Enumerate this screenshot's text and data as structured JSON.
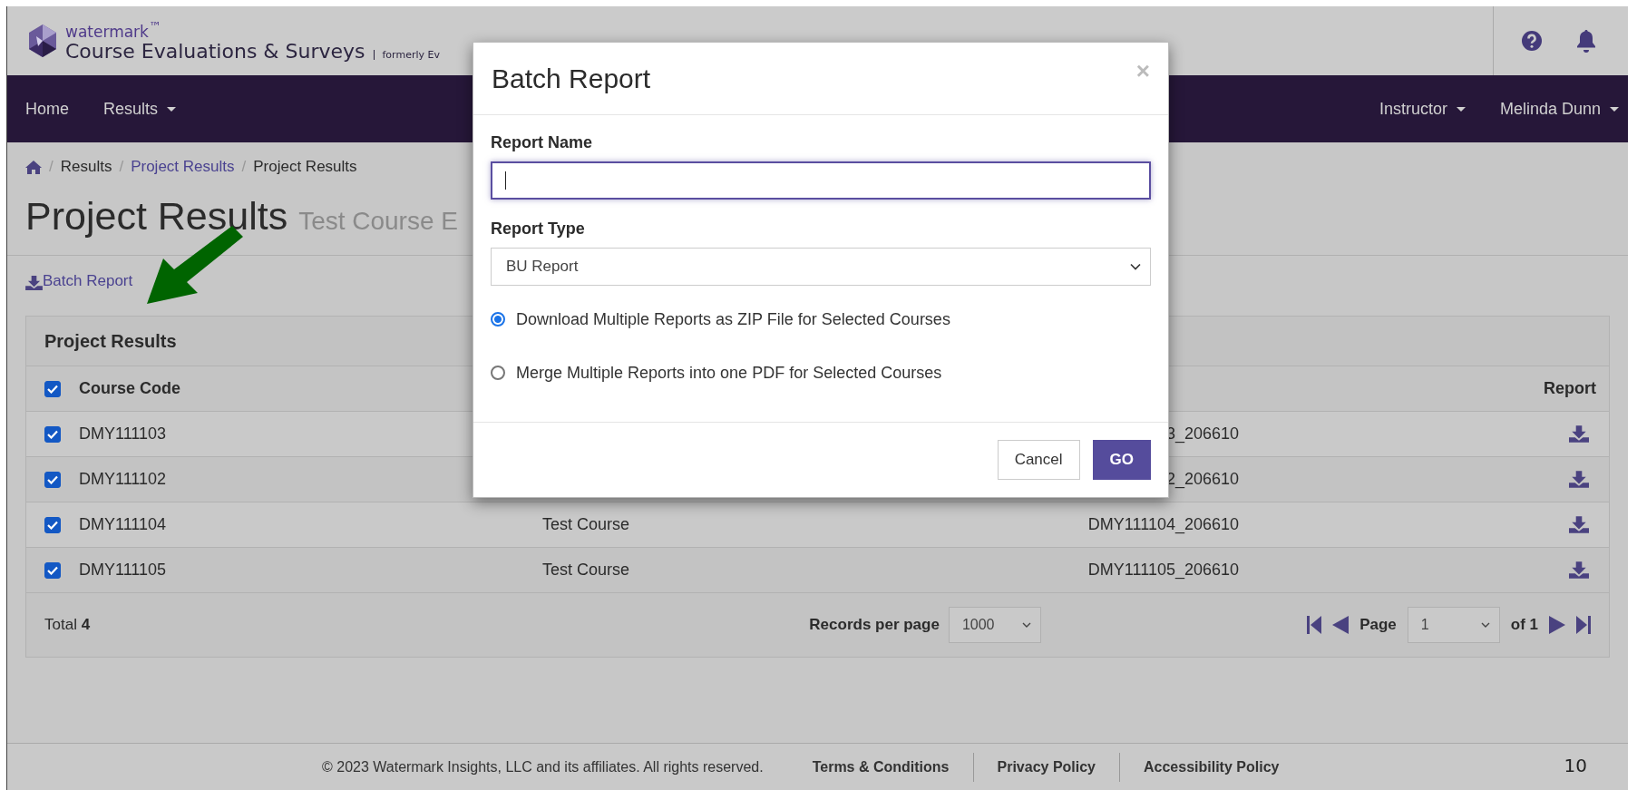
{
  "header": {
    "brand": "watermark$^{™}$",
    "product": "Course Evaluations & Surveys",
    "tagline": "formerly Ev"
  },
  "nav": {
    "left": [
      {
        "label": "Home",
        "dropdown": false
      },
      {
        "label": "Results",
        "dropdown": true
      }
    ],
    "right": [
      {
        "label": "Instructor",
        "dropdown": true
      },
      {
        "label": "Melinda Dunn",
        "dropdown": true
      }
    ]
  },
  "breadcrumb": {
    "separator": "/",
    "items": [
      {
        "label": "Results",
        "link": false
      },
      {
        "label": "Project Results",
        "link": true
      },
      {
        "label": "Project Results",
        "link": false
      }
    ]
  },
  "page_title": "Project Results",
  "page_subtitle": "Test Course E",
  "batch_link": "Batch Report",
  "panel": {
    "title": "Project Results",
    "select_all_checked": true,
    "columns": [
      "Course Code",
      "Report"
    ],
    "rows": [
      {
        "checked": true,
        "course_code": "DMY111103",
        "column_3": "3_206610"
      },
      {
        "checked": true,
        "course_code": "DMY111102",
        "column_3": "2_206610"
      },
      {
        "checked": true,
        "course_code": "DMY111104",
        "column_2": "Test Course",
        "column_3": "DMY111104_206610"
      },
      {
        "checked": true,
        "course_code": "DMY111105",
        "column_2": "Test Course",
        "column_3": "DMY111105_206610"
      }
    ],
    "total": "Total **4**",
    "records_label": "Records per page",
    "records_value": "1000",
    "page_label": "Page",
    "page_value": "1",
    "page_of": "of 1"
  },
  "footer": {
    "copyright": "© 2023 Watermark Insights, LLC and its affiliates. All rights reserved.",
    "links": [
      "Terms & Conditions",
      "Privacy Policy",
      "Accessibility Policy"
    ]
  },
  "slide_number": "10",
  "modal": {
    "title": "Batch Report",
    "close": "×",
    "name_label": "Report Name",
    "name_focused": true,
    "type_label": "Report Type",
    "type_value": "BU Report",
    "options": [
      {
        "label": "Download Multiple Reports as ZIP File for Selected Courses",
        "selected": true
      },
      {
        "label": "Merge Multiple Reports into one PDF for Selected Courses",
        "selected": false
      }
    ],
    "buttons": [
      {
        "label": "Cancel",
        "kind": "default"
      },
      {
        "label": "GO",
        "kind": "primary"
      }
    ]
  }
}
